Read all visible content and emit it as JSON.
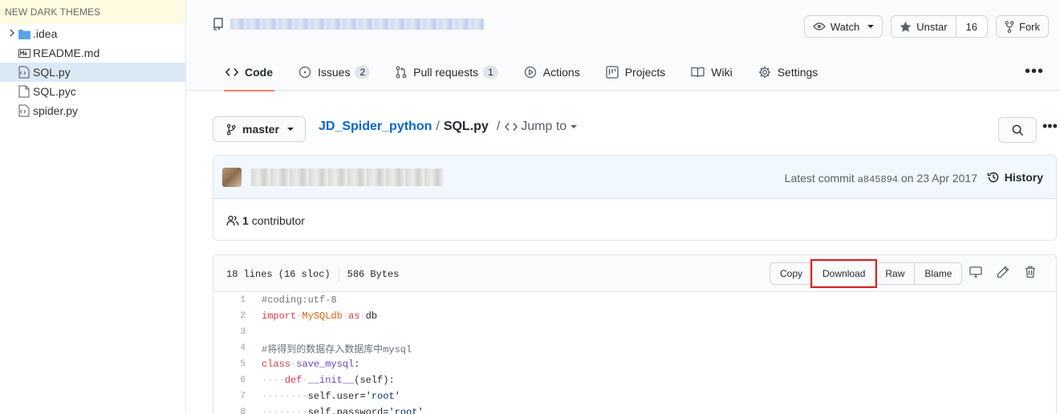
{
  "explorer": {
    "header": "NEW DARK THEMES",
    "items": [
      {
        "label": ".idea",
        "type": "folder",
        "active": false
      },
      {
        "label": "README.md",
        "type": "markdown",
        "active": false
      },
      {
        "label": "SQL.py",
        "type": "python",
        "active": true
      },
      {
        "label": "SQL.pyc",
        "type": "file",
        "active": false
      },
      {
        "label": "spider.py",
        "type": "python",
        "active": false
      }
    ]
  },
  "header": {
    "watch_label": "Watch",
    "unstar_label": "Unstar",
    "star_count": "16",
    "fork_label": "Fork"
  },
  "tabs": [
    {
      "label": "Code",
      "icon": "code-icon",
      "badge": "",
      "selected": true
    },
    {
      "label": "Issues",
      "icon": "issue-icon",
      "badge": "2",
      "selected": false
    },
    {
      "label": "Pull requests",
      "icon": "pull-request-icon",
      "badge": "1",
      "selected": false
    },
    {
      "label": "Actions",
      "icon": "play-icon",
      "badge": "",
      "selected": false
    },
    {
      "label": "Projects",
      "icon": "project-icon",
      "badge": "",
      "selected": false
    },
    {
      "label": "Wiki",
      "icon": "book-icon",
      "badge": "",
      "selected": false
    },
    {
      "label": "Settings",
      "icon": "gear-icon",
      "badge": "",
      "selected": false
    }
  ],
  "filenav": {
    "branch": "master",
    "repo": "JD_Spider_python",
    "separator": "/",
    "file": "SQL.py",
    "jump_label": "Jump to"
  },
  "commit": {
    "latest_label": "Latest commit",
    "sha": "a845894",
    "date_text": "on 23 Apr 2017",
    "history_label": "History",
    "contributors_count": "1",
    "contributors_label": "contributor"
  },
  "file": {
    "lines_info": "18 lines (16 sloc)",
    "size": "586 Bytes",
    "copy_label": "Copy",
    "download_label": "Download",
    "raw_label": "Raw",
    "blame_label": "Blame"
  },
  "code_lines": [
    {
      "n": "1",
      "text": "#coding:utf-8"
    },
    {
      "n": "2",
      "text": "import MySQLdb as db"
    },
    {
      "n": "3",
      "text": ""
    },
    {
      "n": "4",
      "text": "#将得到的数据存入数据库中mysql"
    },
    {
      "n": "5",
      "text": "class save_mysql:"
    },
    {
      "n": "6",
      "text": "    def __init__(self):"
    },
    {
      "n": "7",
      "text": "        self.user='root'"
    },
    {
      "n": "8",
      "text": "        self.password='root'"
    }
  ],
  "colors": {
    "accent_underline": "#f9826c",
    "link": "#0366d6",
    "highlight_box": "#e0201c",
    "explorer_active": "#dbe9f7",
    "explorer_header_bg": "#fffbe0"
  }
}
